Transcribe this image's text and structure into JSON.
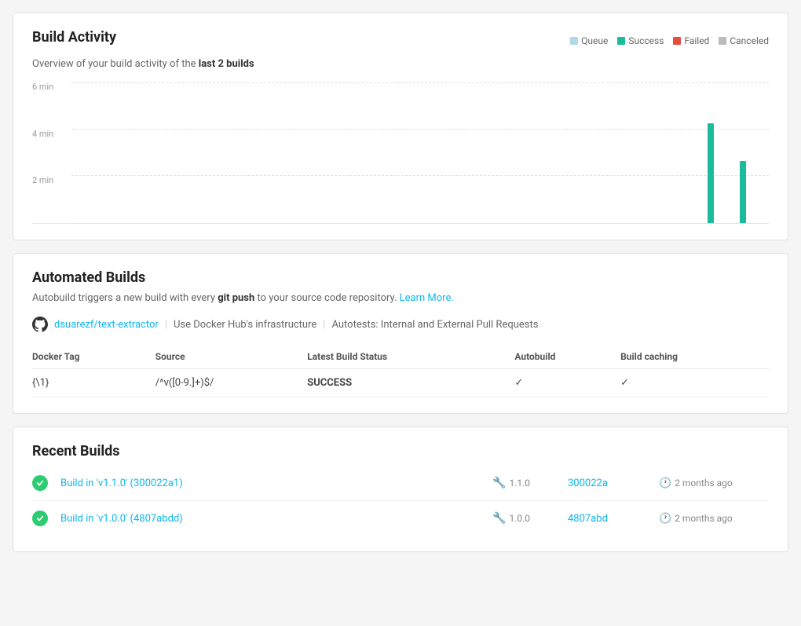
{
  "buildActivity": {
    "title": "Build Activity",
    "subtitle_prefix": "Overview of your build activity of the ",
    "subtitle_bold": "last 2 builds",
    "legend": [
      {
        "label": "Queue",
        "color": "#b0d8e8"
      },
      {
        "label": "Success",
        "color": "#1abc9c"
      },
      {
        "label": "Failed",
        "color": "#e74c3c"
      },
      {
        "label": "Canceled",
        "color": "#bbb"
      }
    ],
    "yAxis": [
      "6 min",
      "4 min",
      "2 min",
      ""
    ],
    "bars": [
      {
        "success": 0,
        "queue": 0
      },
      {
        "success": 0,
        "queue": 0
      },
      {
        "success": 0,
        "queue": 0
      },
      {
        "success": 0,
        "queue": 0
      },
      {
        "success": 0,
        "queue": 0
      },
      {
        "success": 0,
        "queue": 0
      },
      {
        "success": 0,
        "queue": 0
      },
      {
        "success": 0,
        "queue": 0
      },
      {
        "success": 0,
        "queue": 0
      },
      {
        "success": 0,
        "queue": 0
      },
      {
        "success": 0,
        "queue": 0
      },
      {
        "success": 0,
        "queue": 0
      },
      {
        "success": 0,
        "queue": 0
      },
      {
        "success": 0,
        "queue": 0
      },
      {
        "success": 0,
        "queue": 0
      },
      {
        "success": 0,
        "queue": 0
      },
      {
        "success": 0,
        "queue": 0
      },
      {
        "success": 0,
        "queue": 0
      },
      {
        "success": 0,
        "queue": 0
      },
      {
        "success": 4.5,
        "queue": 0
      },
      {
        "success": 2.8,
        "queue": 0
      }
    ]
  },
  "automatedBuilds": {
    "title": "Automated Builds",
    "description_prefix": "Autobuild triggers a new build with every ",
    "description_bold": "git push",
    "description_suffix": " to your source code repository. ",
    "learn_more": "Learn More.",
    "repo_link": "dsuarezf/text-extractor",
    "repo_info_1": "Use Docker Hub's infrastructure",
    "repo_info_2": "Autotests: Internal and External Pull Requests",
    "table": {
      "headers": [
        "Docker Tag",
        "Source",
        "Latest Build Status",
        "Autobuild",
        "Build caching"
      ],
      "rows": [
        {
          "tag": "{\\1}",
          "source": "/^v([0-9.]+)$/",
          "status": "SUCCESS",
          "autobuild": "✓",
          "caching": "✓"
        }
      ]
    }
  },
  "recentBuilds": {
    "title": "Recent Builds",
    "builds": [
      {
        "id": "build-1",
        "label": "Build in 'v1.1.0' (300022a1)",
        "tag": "1.1.0",
        "commit": "300022a",
        "time": "2 months ago"
      },
      {
        "id": "build-2",
        "label": "Build in 'v1.0.0' (4807abdd)",
        "tag": "1.0.0",
        "commit": "4807abd",
        "time": "2 months ago"
      }
    ]
  }
}
